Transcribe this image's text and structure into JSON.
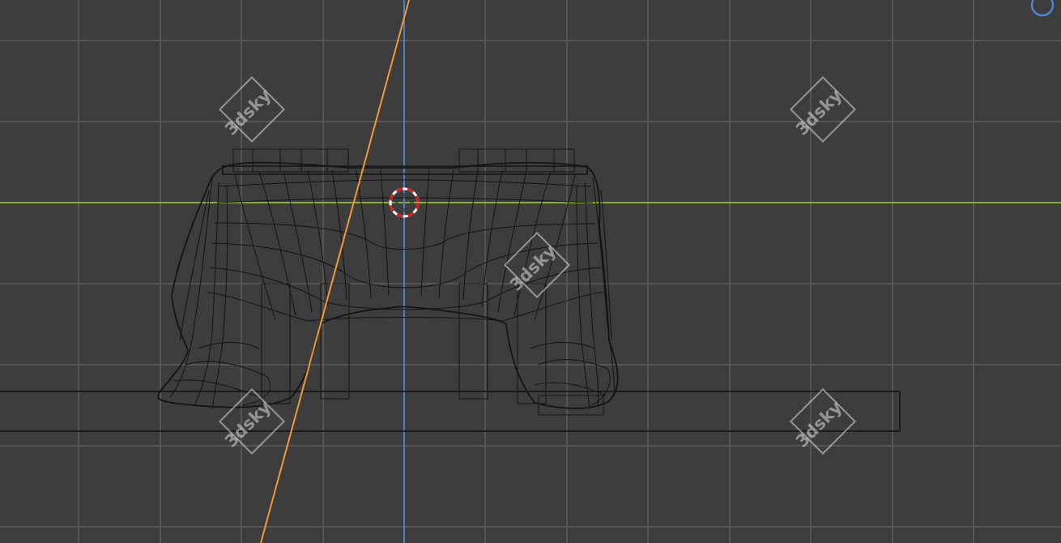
{
  "viewport": {
    "mode": "wireframe",
    "view": "front orthographic",
    "background_color": "#3d3d3d",
    "grid_color": "#555555",
    "grid": true
  },
  "axes": {
    "x_axis_color": "#84b030",
    "z_axis_color": "#4f7fc4",
    "camera_line_color": "#f09a36"
  },
  "cursor": {
    "name": "3d-cursor",
    "colors": [
      "#d02020",
      "#ffffff"
    ]
  },
  "wireframe_color": "#141414",
  "nav_gizmo_color": "#4f86d0",
  "watermarks": [
    {
      "text": "3dsky"
    },
    {
      "text": "3dsky"
    },
    {
      "text": "3dsky"
    },
    {
      "text": "3dsky"
    },
    {
      "text": "3dsky"
    }
  ]
}
